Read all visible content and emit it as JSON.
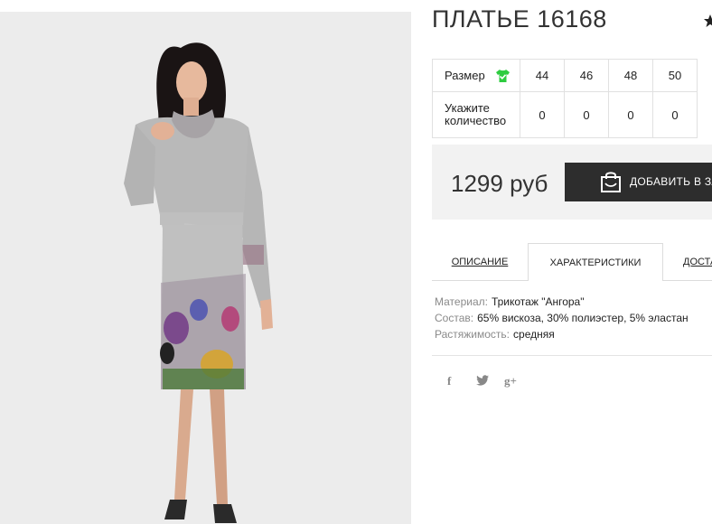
{
  "product": {
    "title": "ПЛАТЬЕ 16168",
    "image_alt": "dress-photo"
  },
  "sizes_table": {
    "size_label": "Размер",
    "quantity_label": "Укажите количество",
    "sizes": [
      "44",
      "46",
      "48",
      "50"
    ],
    "quantities": [
      "0",
      "0",
      "0",
      "0"
    ],
    "size_icon": "tshirt-check-icon",
    "size_icon_color": "#2ecc40"
  },
  "purchase": {
    "price": "1299 руб",
    "add_to_cart_label": "ДОБАВИТЬ В ЗАКАЗ",
    "cart_icon": "shopping-bag-icon",
    "button_color": "#2d2d2d"
  },
  "tabs": {
    "description": "ОПИСАНИЕ",
    "characteristics": "ХАРАКТЕРИСТИКИ",
    "delivery": "ДОСТАВКА",
    "active": "characteristics"
  },
  "specs": [
    {
      "key": "Материал:",
      "value": "Трикотаж \"Ангора\""
    },
    {
      "key": "Состав:",
      "value": "65% вискоза, 30% полиэстер, 5% эластан"
    },
    {
      "key": "Растяжимость:",
      "value": "средняя"
    }
  ],
  "social": {
    "facebook": "f",
    "twitter": "twitter-icon",
    "googleplus": "g+"
  },
  "favorite_icon": "star-icon"
}
